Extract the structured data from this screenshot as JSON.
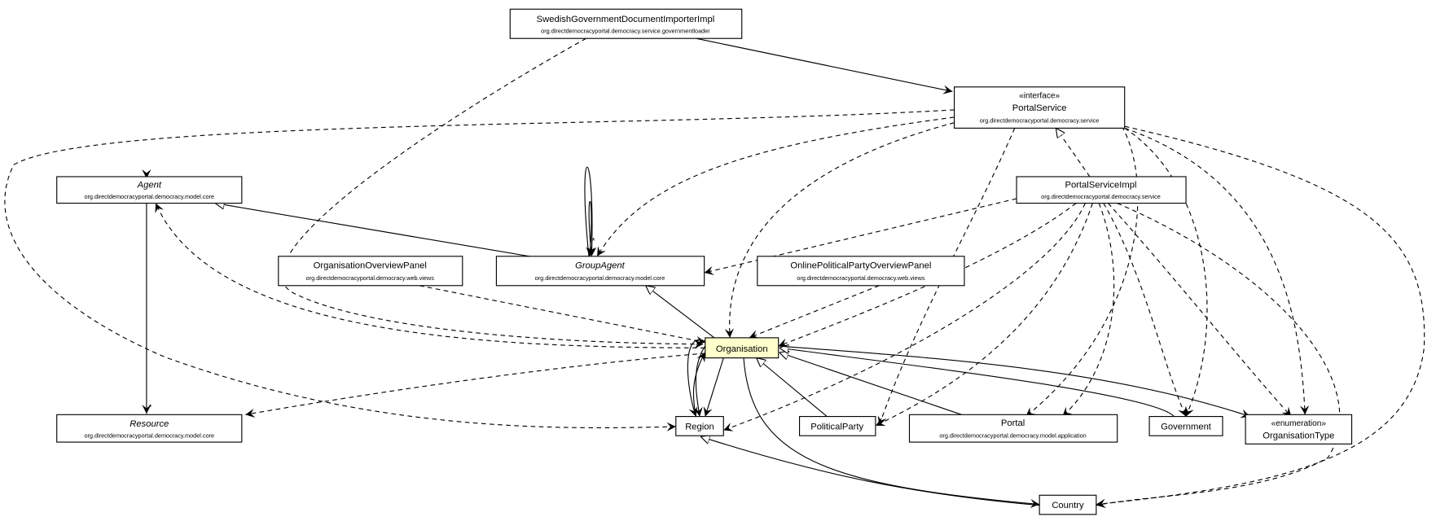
{
  "classes": {
    "swedish": {
      "name": "SwedishGovernmentDocumentImporterImpl",
      "package": "org.directdemocracyportal.democracy.service.governmentloader"
    },
    "portalService": {
      "stereotype": "«interface»",
      "name": "PortalService",
      "package": "org.directdemocracyportal.democracy.service"
    },
    "agent": {
      "name": "Agent",
      "package": "org.directdemocracyportal.democracy.model.core",
      "abstract": true
    },
    "groupAgent": {
      "name": "GroupAgent",
      "package": "org.directdemocracyportal.democracy.model.core",
      "abstract": true
    },
    "orgOverview": {
      "name": "OrganisationOverviewPanel",
      "package": "org.directdemocracyportal.democracy.web.views"
    },
    "onlineOverview": {
      "name": "OnlinePoliticalPartyOverviewPanel",
      "package": "org.directdemocracyportal.democracy.web.views"
    },
    "portalServiceImpl": {
      "name": "PortalServiceImpl",
      "package": "org.directdemocracyportal.democracy.service"
    },
    "organisation": {
      "name": "Organisation",
      "highlight_color": "#ffffcc"
    },
    "resource": {
      "name": "Resource",
      "package": "org.directdemocracyportal.democracy.model.core",
      "abstract": true
    },
    "region": {
      "name": "Region"
    },
    "politicalParty": {
      "name": "PoliticalParty"
    },
    "portal": {
      "name": "Portal",
      "package": "org.directdemocracyportal.democracy.model.application"
    },
    "government": {
      "name": "Government"
    },
    "organisationType": {
      "stereotype": "«enumeration»",
      "name": "OrganisationType"
    },
    "country": {
      "name": "Country"
    }
  },
  "multiplicity": "*"
}
